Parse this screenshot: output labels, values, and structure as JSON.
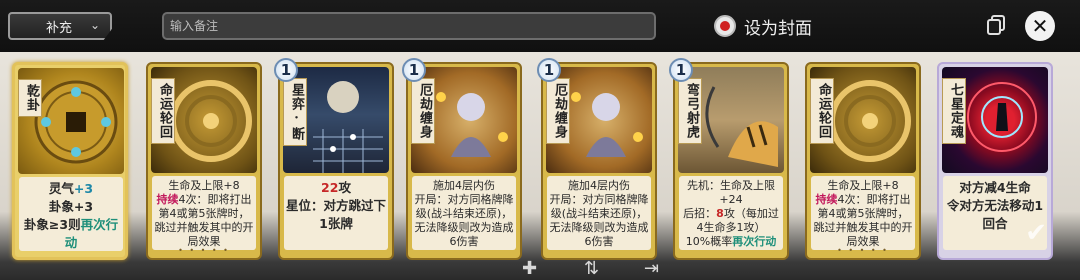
{
  "toolbar": {
    "category_label": "补充",
    "note_placeholder": "输入备注",
    "cover_label": "设为封面"
  },
  "cards": [
    {
      "title": "乾卦",
      "cost": "",
      "desc_html": "灵气<span class='bl'>+3</span><br>卦象+3<br>卦象≥3则<span class='green'>再次行动</span>",
      "big": true
    },
    {
      "title": "命运轮回",
      "cost": "",
      "desc_html": "生命及上限+8<br><span class='hl'>持续</span>4次：即将打出第4或第5张牌时，跳过并触发其中的开局效果",
      "big": false
    },
    {
      "title": "星弈·断",
      "cost": "1",
      "desc_html": "<span class='red'>22</span>攻<br>星位：对方跳过下1张牌",
      "big": true
    },
    {
      "title": "厄劫缠身",
      "cost": "1",
      "desc_html": "施加4层内伤<br>开局：对方同格牌降级(战斗结束还原)，无法降级则改为造成6伤害",
      "big": false
    },
    {
      "title": "厄劫缠身",
      "cost": "1",
      "desc_html": "施加4层内伤<br>开局：对方同格牌降级(战斗结束还原)，无法降级则改为造成6伤害",
      "big": false
    },
    {
      "title": "弯弓射虎",
      "cost": "1",
      "desc_html": "先机：生命及上限+24<br>后招：<span class='red'>8</span>攻（每加过4生命多1攻）<br>10%概率<span class='green'>再次行动</span>",
      "big": false
    },
    {
      "title": "命运轮回",
      "cost": "",
      "desc_html": "生命及上限+8<br><span class='hl'>持续</span>4次：即将打出第4或第5张牌时，跳过并触发其中的开局效果",
      "big": false
    },
    {
      "title": "七星定魂",
      "cost": "",
      "desc_html": "对方减4生命<br>令对方无法移动1回合",
      "big": true
    }
  ],
  "colors": {
    "accent_gold": "#d8b94a",
    "highlight_pink": "#c2185b",
    "highlight_teal": "#1e8f7a",
    "attack_red": "#c62828"
  },
  "icons": [
    "chevron-down-icon",
    "cover-record-icon",
    "copy-icon",
    "close-icon",
    "add-icon",
    "sort-icon",
    "export-icon"
  ]
}
